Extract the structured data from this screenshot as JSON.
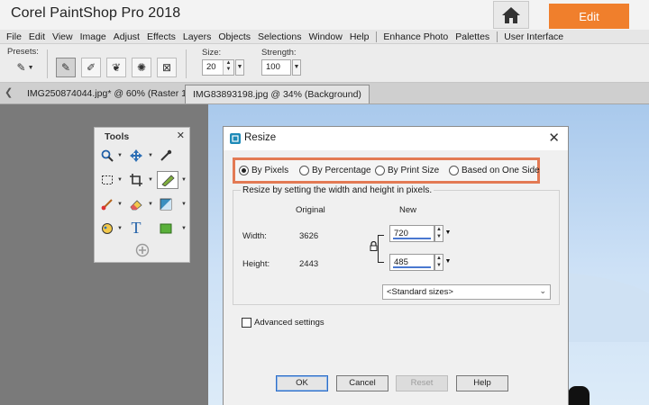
{
  "app": {
    "title": "Corel PaintShop Pro 2018",
    "home_icon": "home-icon",
    "edit_label": "Edit",
    "accent_color": "#f07f2c"
  },
  "menu": [
    "File",
    "Edit",
    "View",
    "Image",
    "Adjust",
    "Effects",
    "Layers",
    "Objects",
    "Selections",
    "Window",
    "Help",
    "Enhance Photo",
    "Palettes",
    "User Interface"
  ],
  "toolbar": {
    "presets_label": "Presets:",
    "size_label": "Size:",
    "size_value": "20",
    "strength_label": "Strength:",
    "strength_value": "100",
    "tools": [
      "brush-icon",
      "pencil-icon",
      "blend-icon",
      "scatter-icon",
      "clone-icon"
    ]
  },
  "tabs": [
    {
      "label": "IMG250874044.jpg* @  60% (Raster 1)",
      "active": false
    },
    {
      "label": "IMG83893198.jpg @  34% (Background)",
      "active": true
    }
  ],
  "tools_palette": {
    "title": "Tools",
    "items": [
      "zoom-icon",
      "move-icon",
      "dropper-icon",
      "selection-icon",
      "crop-icon",
      "straighten-icon",
      "paint-brush-icon",
      "eraser-icon",
      "gradient-icon",
      "fill-icon",
      "text-icon",
      "rectangle-shape-icon",
      "add-tool-icon"
    ]
  },
  "dialog": {
    "title": "Resize",
    "close_glyph": "✕",
    "modes": [
      {
        "label": "By Pixels",
        "selected": true
      },
      {
        "label": "By Percentage",
        "selected": false
      },
      {
        "label": "By Print Size",
        "selected": false
      },
      {
        "label": "Based on One Side",
        "selected": false
      }
    ],
    "highlight_color": "#e37a54",
    "group_caption": "Resize by setting the width and height in pixels.",
    "original_header": "Original",
    "new_header": "New",
    "width_label": "Width:",
    "height_label": "Height:",
    "original_width": "3626",
    "original_height": "2443",
    "new_width": "720",
    "new_height": "485",
    "standard_sizes": "<Standard sizes>",
    "advanced_label": "Advanced settings",
    "advanced_checked": false,
    "buttons": {
      "ok": "OK",
      "cancel": "Cancel",
      "reset": "Reset",
      "help": "Help"
    }
  }
}
